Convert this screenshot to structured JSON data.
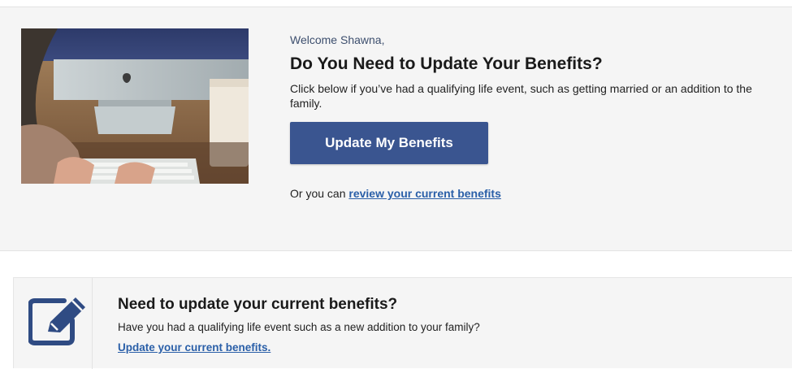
{
  "hero": {
    "welcome": "Welcome Shawna,",
    "title": "Do You Need to Update Your Benefits?",
    "description": "Click below if you’ve had a qualifying life event, such as getting married or an addition to the family.",
    "cta_label": "Update My Benefits",
    "alt_prefix": "Or you can ",
    "alt_link": "review your current benefits",
    "photo_icon": "desk-photo"
  },
  "card": {
    "icon": "edit-icon",
    "title": "Need to update your current benefits?",
    "description": "Have you had a qualifying life event such as a new addition to your family?",
    "link": "Update your current benefits."
  },
  "colors": {
    "accent": "#3a5590",
    "link": "#2a5fa8",
    "panel": "#f5f5f5"
  }
}
